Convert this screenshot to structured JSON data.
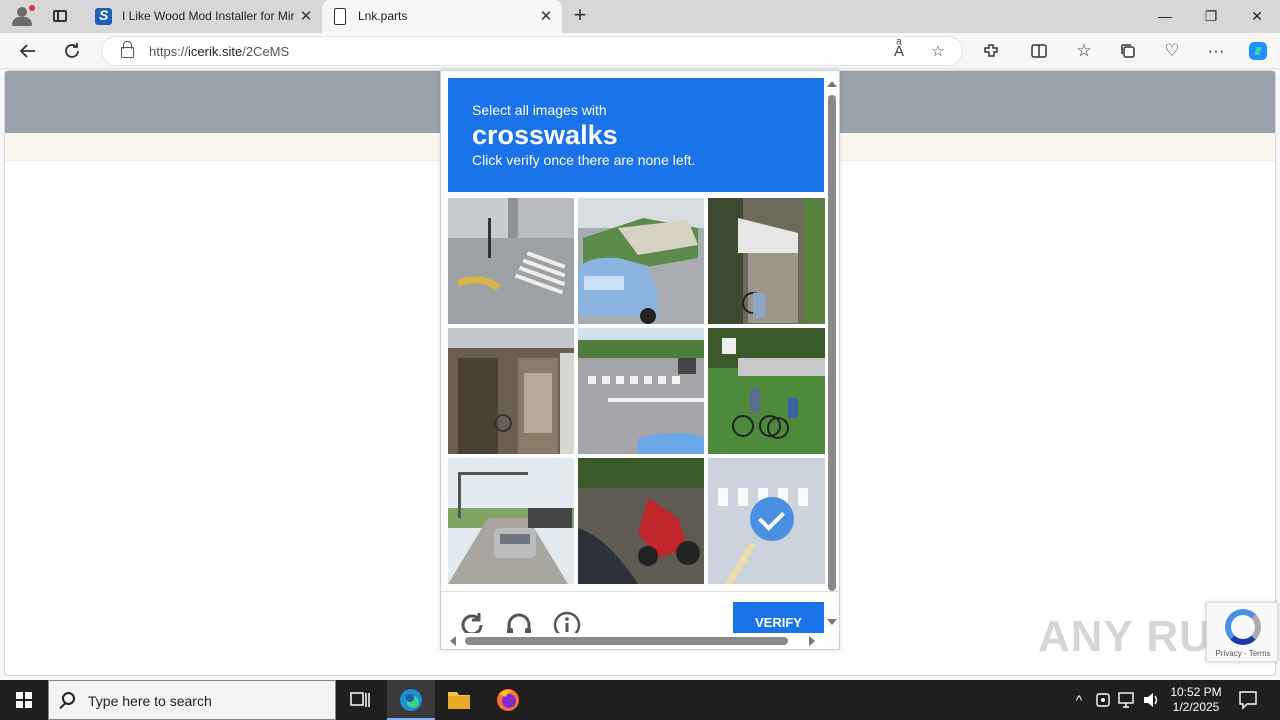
{
  "browser": {
    "tabs": [
      {
        "title": "I Like Wood Mod Installer for Mir",
        "favicon": "wood-favicon",
        "close": "✕"
      },
      {
        "title": "Lnk.parts",
        "favicon": "page-icon",
        "close": "✕"
      }
    ],
    "new_tab": "+",
    "window_controls": {
      "minimize": "—",
      "restore": "❐",
      "close": "✕"
    },
    "address": {
      "scheme": "https://",
      "host": "icerik.site",
      "path": "/2CeMS"
    }
  },
  "captcha": {
    "prompt_line1": "Select all images with",
    "prompt_keyword": "crosswalks",
    "prompt_line3": "Click verify once there are none left.",
    "tiles": [
      {
        "description": "street corner with crosswalk",
        "selected": false
      },
      {
        "description": "parked cars on street",
        "selected": false
      },
      {
        "description": "storefront with bicycle",
        "selected": false
      },
      {
        "description": "old building facade",
        "selected": false
      },
      {
        "description": "road with crosswalk",
        "selected": false
      },
      {
        "description": "cyclists in park",
        "selected": false
      },
      {
        "description": "road with traffic light",
        "selected": false
      },
      {
        "description": "motorcycle on sidewalk",
        "selected": false
      },
      {
        "description": "crosswalk tile",
        "selected": true
      }
    ],
    "verify_label": "VERIFY"
  },
  "recaptcha_badge": {
    "text": "Privacy - Terms"
  },
  "watermark": "ANY RUN",
  "taskbar": {
    "search_placeholder": "Type here to search",
    "time": "10:52 PM",
    "date": "1/2/2025"
  },
  "colors": {
    "captcha_blue": "#1a73e8",
    "taskbar": "#1f1f1f"
  }
}
